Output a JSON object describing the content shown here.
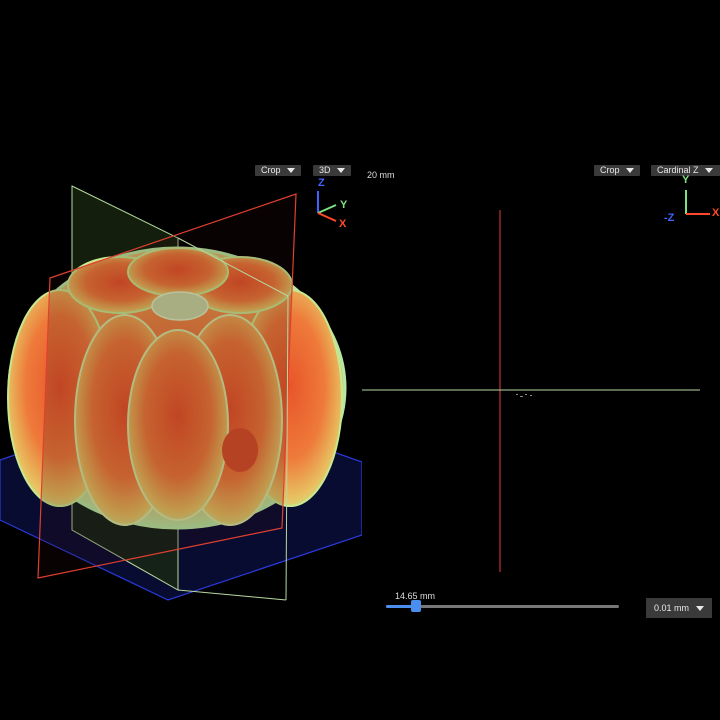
{
  "viewport3d": {
    "crop_label": "Crop",
    "mode_label": "3D",
    "axes": {
      "z": "Z",
      "y": "Y",
      "x": "X"
    }
  },
  "slice_view": {
    "scale_label": "20 mm",
    "crop_label": "Crop",
    "orientation_label": "Cardinal Z",
    "axes": {
      "y": "Y",
      "neg_z": "-Z",
      "x": "X"
    }
  },
  "slider": {
    "value_label": "14.65 mm",
    "position_fraction": 0.13,
    "step_label": "0.01 mm"
  },
  "colors": {
    "accent": "#4a8ef0",
    "axis_x": "#ff4a2a",
    "axis_y": "#7ee07e",
    "axis_z": "#3f63ff",
    "plane_red": "#e04030",
    "plane_green": "#b8d8a0",
    "plane_blue": "#1a2a9a"
  }
}
